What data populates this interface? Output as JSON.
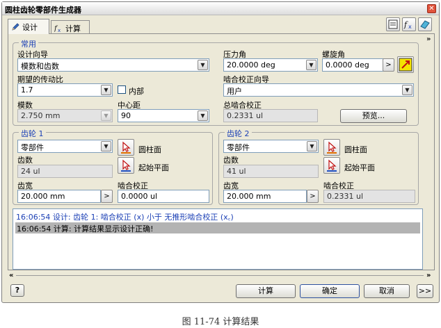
{
  "window": {
    "title": "圆柱齿轮零部件生成器",
    "close_glyph": "✕"
  },
  "tabs": [
    {
      "label": "设计",
      "icon": "pencil-icon"
    },
    {
      "label": "计算",
      "icon": "formula-icon"
    }
  ],
  "header_icons": [
    "properties-icon",
    "fx-icon",
    "eraser-icon"
  ],
  "common": {
    "legend": "常用",
    "design_guide_label": "设计向导",
    "design_guide_value": "模数和齿数",
    "ratio_label": "期望的传动比",
    "ratio_value": "1.7",
    "internal_label": "内部",
    "module_label": "模数",
    "module_value": "2.750 mm",
    "center_label": "中心距",
    "center_value": "90",
    "pressure_label": "压力角",
    "pressure_value": "20.0000 deg",
    "helix_label": "螺旋角",
    "helix_value": "0.0000 deg",
    "mesh_guide_label": "啮合校正向导",
    "mesh_guide_value": "用户",
    "total_mesh_label": "总啮合校正",
    "total_mesh_value": "0.2331 ul",
    "preview_label": "预览..."
  },
  "gear1": {
    "legend": "齿轮 1",
    "type_value": "零部件",
    "cyl_face_label": "圆柱面",
    "teeth_label": "齿数",
    "teeth_value": "24 ul",
    "start_plane_label": "起始平面",
    "width_label": "齿宽",
    "width_value": "20.000 mm",
    "correction_label": "啮合校正",
    "correction_value": "0.0000 ul"
  },
  "gear2": {
    "legend": "齿轮 2",
    "type_value": "零部件",
    "cyl_face_label": "圆柱面",
    "teeth_label": "齿数",
    "teeth_value": "41 ul",
    "start_plane_label": "起始平面",
    "width_label": "齿宽",
    "width_value": "20.000 mm",
    "correction_label": "啮合校正",
    "correction_value": "0.2331 ul"
  },
  "messages": [
    "16:06:54 设计: 齿轮 1: 啮合校正 (x) 小于 无推形啮合校正 (x꜀)",
    "16:06:54 计算: 计算结果显示设计正确!"
  ],
  "footer": {
    "help_glyph": "?",
    "calc_label": "计算",
    "ok_label": "确定",
    "cancel_label": "取消",
    "more_label": ">>"
  },
  "scroll": {
    "left": "«",
    "right": "»",
    "up": "»"
  },
  "caption": "图 11-74  计算结果"
}
